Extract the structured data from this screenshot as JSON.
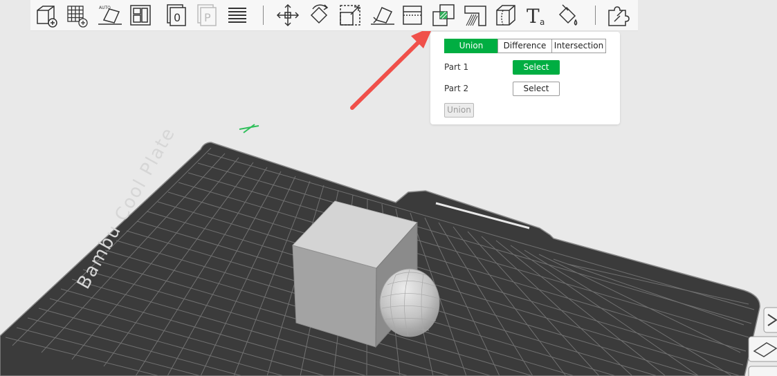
{
  "app": {
    "viewport_background": "#e9e9e9"
  },
  "toolbar": {
    "icons": [
      "add-cube-icon",
      "add-grid-plate-icon",
      "auto-orient-icon",
      "arrange-icon",
      "plate-0-icon",
      "plate-p-icon",
      "layers-icon",
      "move-icon",
      "rotate-icon",
      "scale-icon",
      "lay-on-face-icon",
      "cut-icon",
      "boolean-icon",
      "support-paint-icon",
      "seam-paint-icon",
      "text-icon",
      "color-paint-icon",
      "assembly-icon"
    ],
    "auto_tag": "AUTO",
    "plate_zero": "0",
    "plate_p": "P",
    "text_tool_glyph": "T",
    "text_tool_sub": "a"
  },
  "boolean_panel": {
    "tabs": [
      {
        "label": "Union",
        "active": true
      },
      {
        "label": "Difference",
        "active": false
      },
      {
        "label": "Intersection",
        "active": false
      }
    ],
    "part1_label": "Part 1",
    "part1_button": "Select",
    "part2_label": "Part 2",
    "part2_button": "Select",
    "apply_label": "Union"
  },
  "plate": {
    "label": "Bambu Cool Plate"
  },
  "colors": {
    "accent": "#00ae42",
    "arrow": "#f0504a",
    "plate": "#3b3b3b",
    "grid": "#7b7b7b"
  }
}
